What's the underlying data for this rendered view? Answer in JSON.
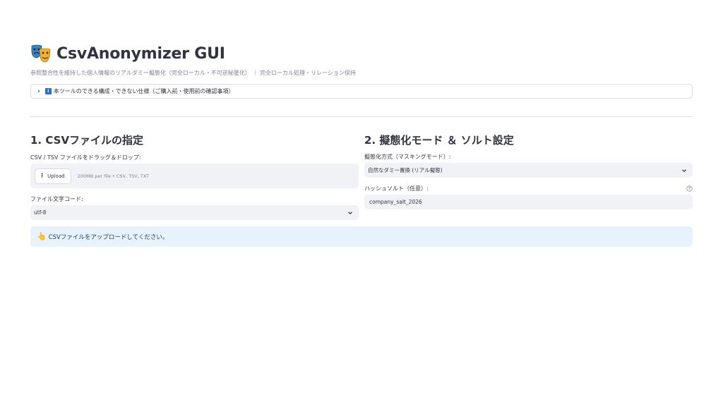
{
  "app": {
    "title": "CsvAnonymizer GUI",
    "icon": "theater-masks-icon",
    "caption": "参照整合性を維持した個人情報のリアルダミー擬態化（完全ローカル・不可逆秘匿化） ｜ 完全ローカル処理・リレーション保持"
  },
  "expander": {
    "label": "本ツールのできる構成・できない仕様（ご購入前・使用前の確認事項）",
    "icon": "info-icon",
    "expanded": false
  },
  "section1": {
    "heading": "1. CSVファイルの指定",
    "uploader": {
      "label": "CSV / TSV ファイルをドラッグ＆ドロップ:",
      "button_label": "Upload",
      "hint": "200MB per file • CSV, TSV, TXT"
    },
    "encoding": {
      "label": "ファイル文字コード:",
      "value": "utf-8"
    }
  },
  "section2": {
    "heading": "2. 擬態化モード ＆ ソルト設定",
    "mode": {
      "label": "擬態化方式（マスキングモード）:",
      "value": "自然なダミー置換 (リアル擬態)"
    },
    "salt": {
      "label": "ハッシュソルト（任意）:",
      "value": "company_salt_2026"
    }
  },
  "info": {
    "message": "CSVファイルをアップロードしてください。",
    "icon": "pointing-hand-icon"
  },
  "colors": {
    "text": "#31333f",
    "muted": "#808495",
    "input_bg": "#f0f2f6",
    "info_bg": "#e8f2fc",
    "info_text": "#1c3a6e",
    "accent_blue": "#2f6fce"
  }
}
